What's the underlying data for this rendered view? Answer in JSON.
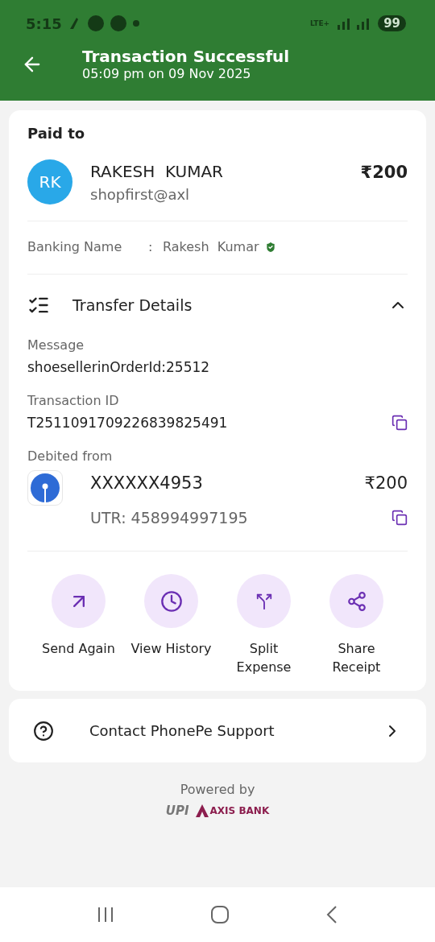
{
  "status_bar": {
    "time": "5:15",
    "network": "LTE+",
    "battery": "99"
  },
  "header": {
    "title": "Transaction Successful",
    "subtitle": "05:09 pm on 09 Nov 2025"
  },
  "payee": {
    "heading": "Paid to",
    "initials": "RK",
    "name": "RAKESH  KUMAR",
    "upi_id": "shopfirst@axl",
    "amount": "₹200",
    "banking_label": "Banking Name",
    "separator": ":",
    "banking_name": "Rakesh  Kumar",
    "verified": true
  },
  "transfer_details": {
    "title": "Transfer Details",
    "expanded": true,
    "fields": [
      {
        "label": "Message",
        "value": "shoesellerinOrderId:25512",
        "copyable": false
      },
      {
        "label": "Transaction ID",
        "value": "T2511091709226839825491",
        "copyable": true
      }
    ],
    "debited": {
      "label": "Debited from",
      "account": "XXXXXX4953",
      "amount": "₹200",
      "utr": "UTR: 458994997195"
    }
  },
  "actions": [
    {
      "kind": "send",
      "label": "Send Again"
    },
    {
      "kind": "history",
      "label": "View History"
    },
    {
      "kind": "split",
      "label": "Split Expense"
    },
    {
      "kind": "share",
      "label": "Share Receipt"
    }
  ],
  "support": {
    "label": "Contact PhonePe Support"
  },
  "footer": {
    "powered_by": "Powered by",
    "logos": [
      "UPI",
      "AXIS BANK"
    ]
  }
}
